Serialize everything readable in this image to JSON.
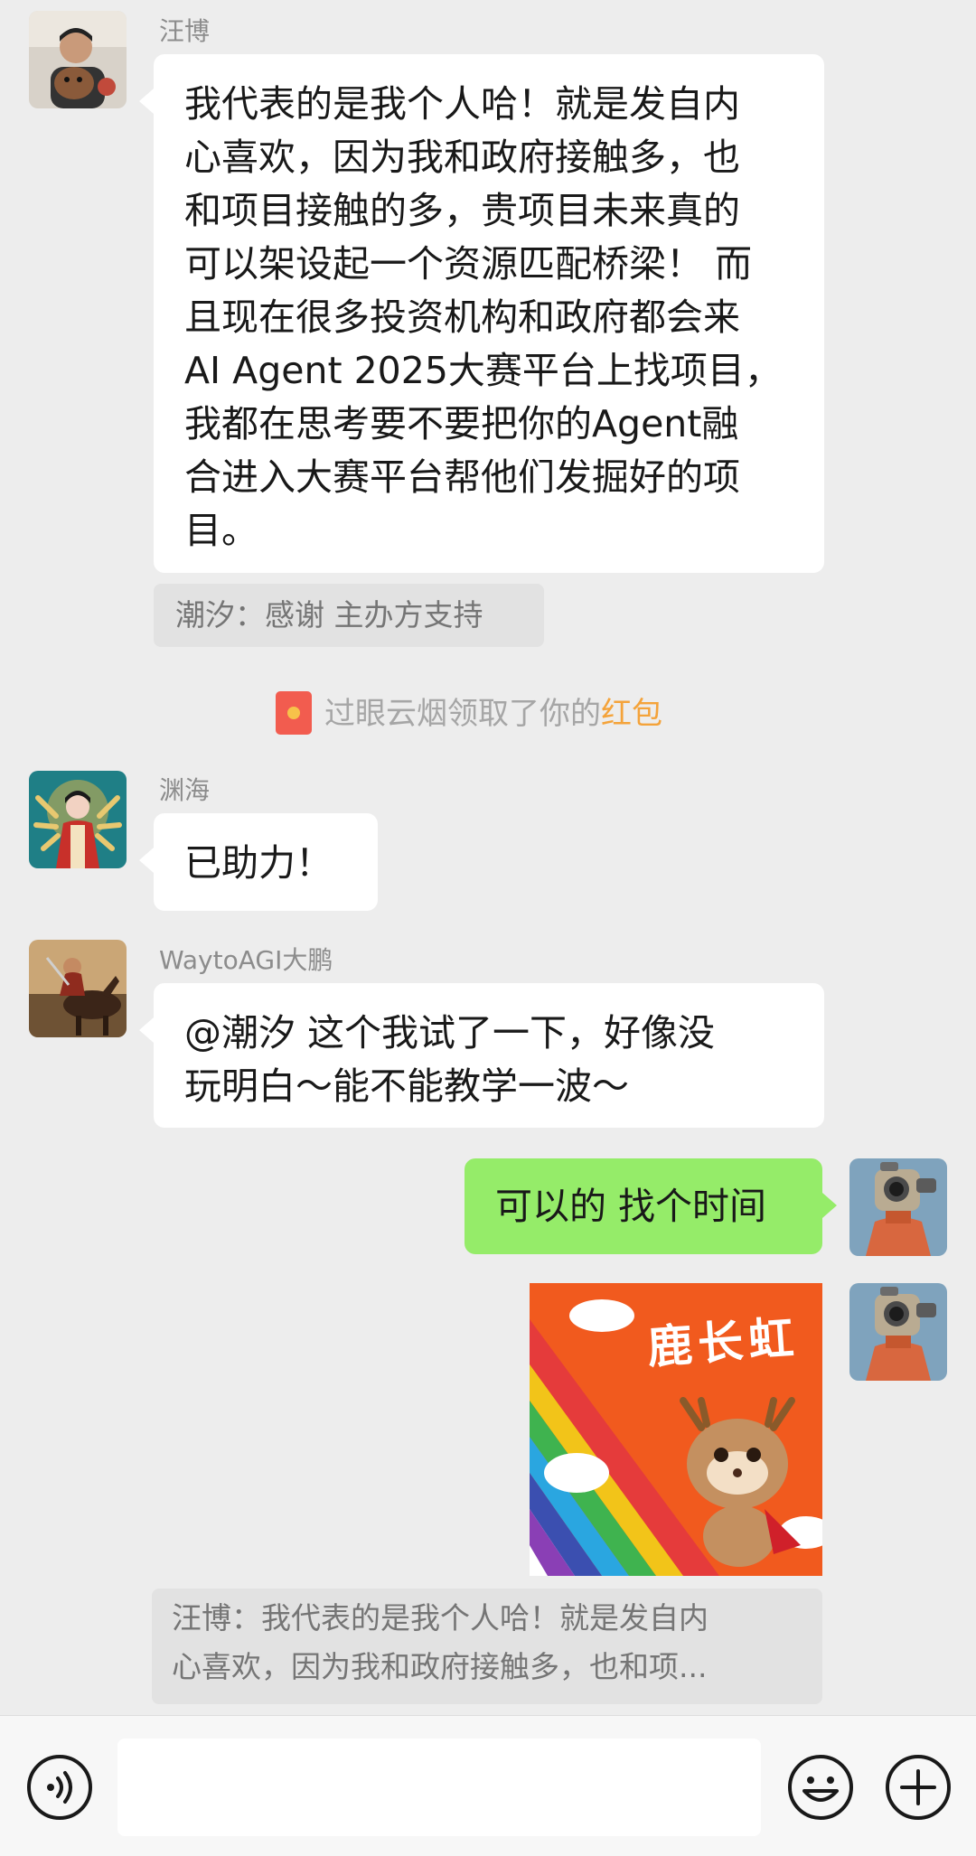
{
  "messages": {
    "m1": {
      "sender": "汪博",
      "text": "我代表的是我个人哈！就是发自内心喜欢，因为我和政府接触多，也和项目接触的多，贵项目未来真的可以架设起一个资源匹配桥梁！ 而且现在很多投资机构和政府都会来AI Agent 2025大赛平台上找项目，我都在思考要不要把你的Agent融合进入大赛平台帮他们发掘好的项目。",
      "lines": [
        "我代表的是我个人哈！就是发自内",
        "心喜欢，因为我和政府接触多，也",
        "和项目接触的多，贵项目未来真的",
        "可以架设起一个资源匹配桥梁！ 而",
        "且现在很多投资机构和政府都会来",
        "AI Agent 2025大赛平台上找项目，",
        "我都在思考要不要把你的Agent融",
        "合进入大赛平台帮他们发掘好的项",
        "目。"
      ],
      "quote": "潮汐：感谢 主办方支持"
    },
    "system": {
      "name": "过眼云烟",
      "text": "领取了你的",
      "highlight": "红包"
    },
    "m2": {
      "sender": "渊海",
      "text": "已助力！"
    },
    "m3": {
      "sender": "WaytoAGI大鹏",
      "lines": [
        "@潮汐  这个我试了一下，好像没",
        "玩明白～能不能教学一波～"
      ]
    },
    "m4": {
      "text": "可以的 找个时间"
    },
    "m5": {
      "sticker_text": "鹿长虹",
      "quote_lines": [
        "汪博：我代表的是我个人哈！就是发自内",
        "心喜欢，因为我和政府接触多，也和项..."
      ]
    }
  },
  "input_bar": {
    "voice_icon": "voice-icon",
    "emoji_icon": "emoji-icon",
    "plus_icon": "plus-icon"
  },
  "colors": {
    "background": "#ededed",
    "bubble_left": "#ffffff",
    "bubble_right": "#95ec69",
    "quote_bg": "#e2e2e2",
    "highlight": "#f4a33a"
  }
}
